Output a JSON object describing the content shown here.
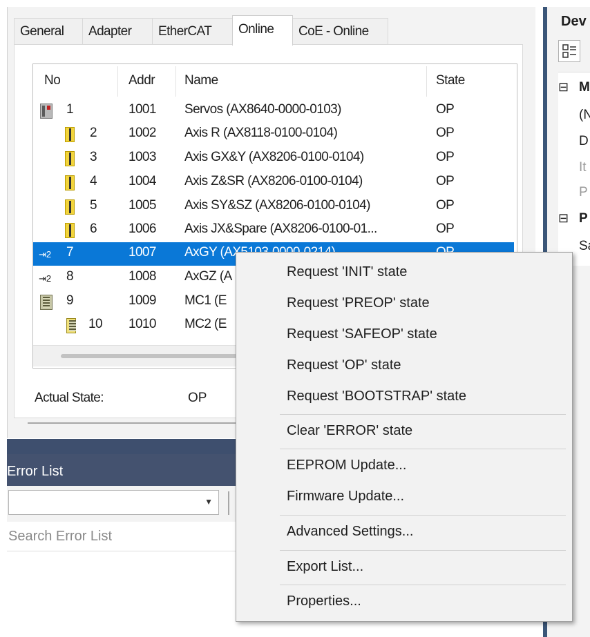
{
  "tabs": [
    "General",
    "Adapter",
    "EtherCAT",
    "Online",
    "CoE - Online"
  ],
  "active_tab": "Online",
  "table": {
    "headers": {
      "no": "No",
      "addr": "Addr",
      "name": "Name",
      "state": "State"
    },
    "rows": [
      {
        "no": "1",
        "addr": "1001",
        "name": "Servos (AX8640-0000-0103)",
        "state": "OP",
        "icon": "device-icon"
      },
      {
        "no": "2",
        "addr": "1002",
        "name": "Axis R (AX8118-0100-0104)",
        "state": "OP",
        "icon": "axis-module-icon"
      },
      {
        "no": "3",
        "addr": "1003",
        "name": "Axis GX&Y (AX8206-0100-0104)",
        "state": "OP",
        "icon": "axis-module-icon"
      },
      {
        "no": "4",
        "addr": "1004",
        "name": "Axis Z&SR (AX8206-0100-0104)",
        "state": "OP",
        "icon": "axis-module-icon"
      },
      {
        "no": "5",
        "addr": "1005",
        "name": "Axis SY&SZ (AX8206-0100-0104)",
        "state": "OP",
        "icon": "axis-module-icon"
      },
      {
        "no": "6",
        "addr": "1006",
        "name": "Axis JX&Spare (AX8206-0100-01...",
        "state": "OP",
        "icon": "axis-module-icon"
      },
      {
        "no": "7",
        "addr": "1007",
        "name": "AxGY (AX5103-0000-0214)",
        "state": "OP",
        "icon": "drive-link-icon"
      },
      {
        "no": "8",
        "addr": "1008",
        "name": "AxGZ (A",
        "state": "",
        "icon": "drive-link-icon"
      },
      {
        "no": "9",
        "addr": "1009",
        "name": "MC1 (E",
        "state": "",
        "icon": "motion-controller-icon"
      },
      {
        "no": "10",
        "addr": "1010",
        "name": "MC2 (E",
        "state": "",
        "icon": "motion-module-icon"
      }
    ],
    "selected_no": "7"
  },
  "actual_state": {
    "label": "Actual State:",
    "value": "OP"
  },
  "error_list": {
    "title": "Error List",
    "search_placeholder": "Search Error List",
    "combo_value": ""
  },
  "right_panel": {
    "title": "Dev",
    "rows": [
      {
        "sym": "⊟",
        "text": "M",
        "style": "bold"
      },
      {
        "sym": "",
        "text": "(N",
        "style": "normal"
      },
      {
        "sym": "",
        "text": "D",
        "style": "normal"
      },
      {
        "sym": "",
        "text": "It",
        "style": "grey"
      },
      {
        "sym": "",
        "text": "P",
        "style": "grey"
      },
      {
        "sym": "⊟",
        "text": "P",
        "style": "bold"
      },
      {
        "sym": "",
        "text": "Sa",
        "style": "normal"
      }
    ]
  },
  "context_menu": {
    "items": [
      "Request 'INIT' state",
      "Request 'PREOP' state",
      "Request 'SAFEOP' state",
      "Request 'OP' state",
      "Request 'BOOTSTRAP' state",
      "Clear 'ERROR' state",
      "EEPROM Update...",
      "Firmware Update...",
      "Advanced Settings...",
      "Export List...",
      "Properties..."
    ]
  },
  "colors": {
    "selection": "#0a78d7",
    "panel_header": "#44526f",
    "menu_bg": "#f2f2f2"
  }
}
